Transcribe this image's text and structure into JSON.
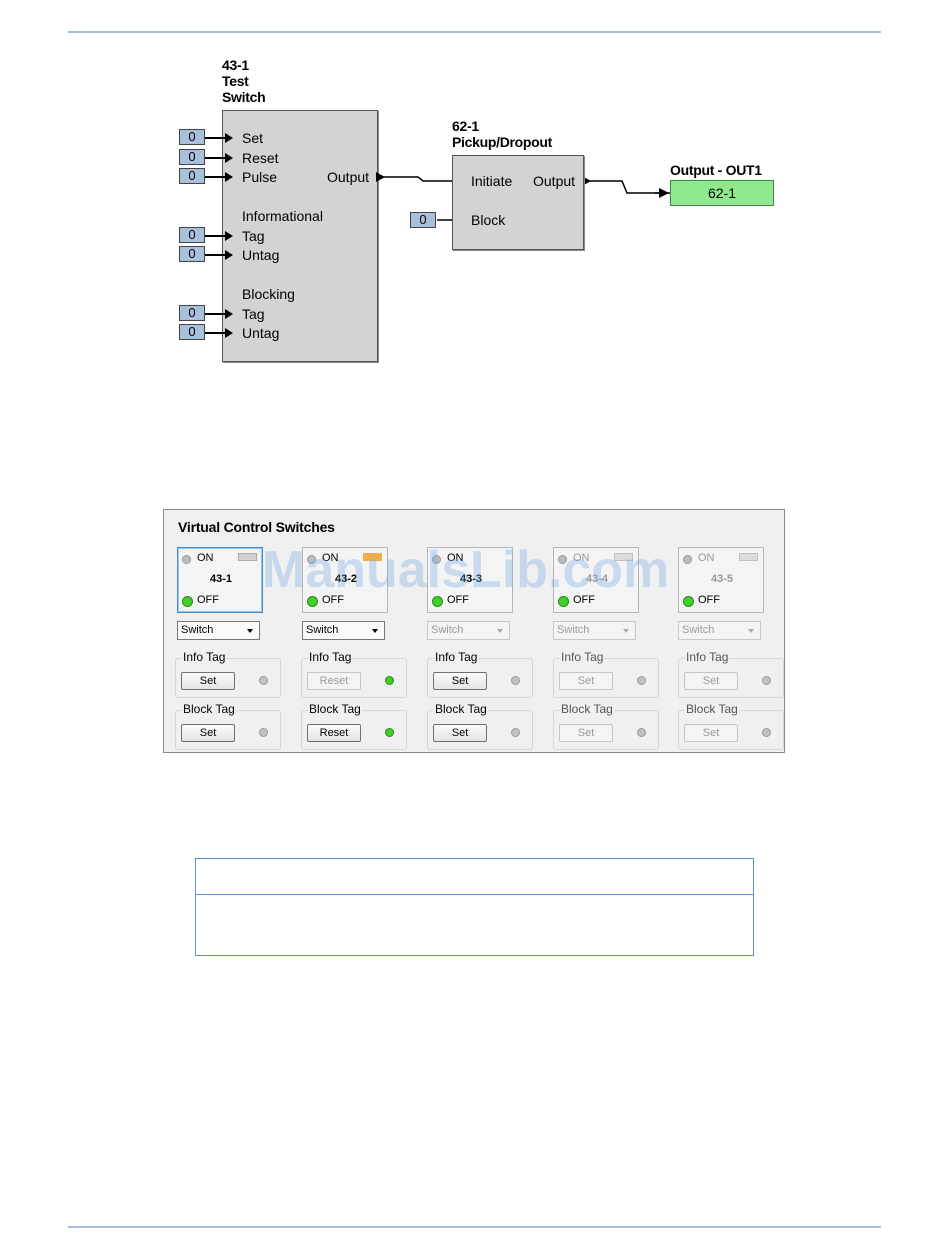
{
  "diagram": {
    "switch_block": {
      "title_lines": [
        "43-1",
        "Test",
        "Switch"
      ],
      "inputs": [
        "Set",
        "Reset",
        "Pulse"
      ],
      "informational_label": "Informational",
      "informational_inputs": [
        "Tag",
        "Untag"
      ],
      "blocking_label": "Blocking",
      "blocking_inputs": [
        "Tag",
        "Untag"
      ],
      "output_label": "Output",
      "input_values": [
        "0",
        "0",
        "0",
        "0",
        "0",
        "0",
        "0"
      ]
    },
    "pickup_block": {
      "title_lines": [
        "62-1",
        "Pickup/Dropout"
      ],
      "initiate_label": "Initiate",
      "block_label": "Block",
      "output_label": "Output",
      "block_input_value": "0"
    },
    "output": {
      "title": "Output - OUT1",
      "value": "62-1",
      "color": "#90e88e"
    }
  },
  "panel": {
    "title": "Virtual Control Switches",
    "switches": [
      {
        "name": "43-1",
        "on_label": "ON",
        "off_label": "OFF",
        "dropdown": "Switch",
        "info_tag_label": "Info Tag",
        "info_button": "Set",
        "info_led": "off",
        "block_tag_label": "Block Tag",
        "block_button": "Set",
        "block_led": "off",
        "enabled": true
      },
      {
        "name": "43-2",
        "on_label": "ON",
        "off_label": "OFF",
        "dropdown": "Switch",
        "info_tag_label": "Info Tag",
        "info_button": "Reset",
        "info_led": "on",
        "block_tag_label": "Block Tag",
        "block_button": "Reset",
        "block_led": "on",
        "enabled": true
      },
      {
        "name": "43-3",
        "on_label": "ON",
        "off_label": "OFF",
        "dropdown": "Switch",
        "info_tag_label": "Info Tag",
        "info_button": "Set",
        "info_led": "off",
        "block_tag_label": "Block Tag",
        "block_button": "Set",
        "block_led": "off",
        "enabled": true
      },
      {
        "name": "43-4",
        "on_label": "ON",
        "off_label": "OFF",
        "dropdown": "Switch",
        "info_tag_label": "Info Tag",
        "info_button": "Set",
        "info_led": "off",
        "block_tag_label": "Block Tag",
        "block_button": "Set",
        "block_led": "off",
        "enabled": false
      },
      {
        "name": "43-5",
        "on_label": "ON",
        "off_label": "OFF",
        "dropdown": "Switch",
        "info_tag_label": "Info Tag",
        "info_button": "Set",
        "info_led": "off",
        "block_tag_label": "Block Tag",
        "block_button": "Set",
        "block_led": "off",
        "enabled": false
      }
    ],
    "tag_indicator_color": "#f0ad4e",
    "led_on_color": "#3fcf28"
  },
  "watermark": "ManualsLib.com"
}
